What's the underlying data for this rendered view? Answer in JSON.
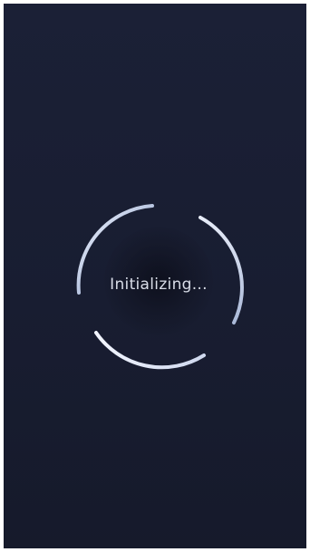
{
  "loading_screen": {
    "status_text": "Initializing...",
    "colors": {
      "background_top": "#1b2036",
      "background_bottom": "#161a2b",
      "arc_start": "#7f97c4",
      "arc_end": "#f2f5ff",
      "text": "#d9dde8"
    },
    "spinner_icon": "loading-spinner-icon"
  }
}
